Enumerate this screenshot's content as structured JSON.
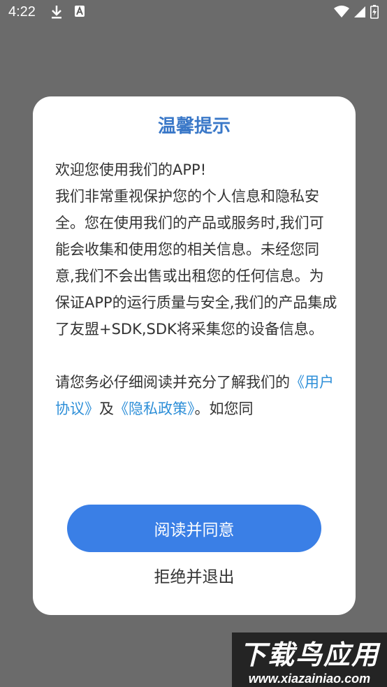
{
  "status_bar": {
    "time": "4:22"
  },
  "dialog": {
    "title": "温馨提示",
    "body": {
      "line1": "欢迎您使用我们的APP!",
      "paragraph1": "我们非常重视保护您的个人信息和隐私安全。您在使用我们的产品或服务时,我们可能会收集和使用您的相关信息。未经您同意,我们不会出售或出租您的任何信息。为保证APP的运行质量与安全,我们的产品集成了友盟+SDK,SDK将采集您的设备信息。",
      "paragraph2_prefix": "请您务必仔细阅读并充分了解我们的",
      "user_agreement_link": "《用户协议》",
      "and": "及",
      "privacy_policy_link": "《隐私政策》",
      "paragraph2_suffix": "。如您同"
    },
    "agree_button": "阅读并同意",
    "reject_button": "拒绝并退出"
  },
  "watermark": {
    "title": "下载鸟应用",
    "url": "www.xiazainiao.com"
  }
}
